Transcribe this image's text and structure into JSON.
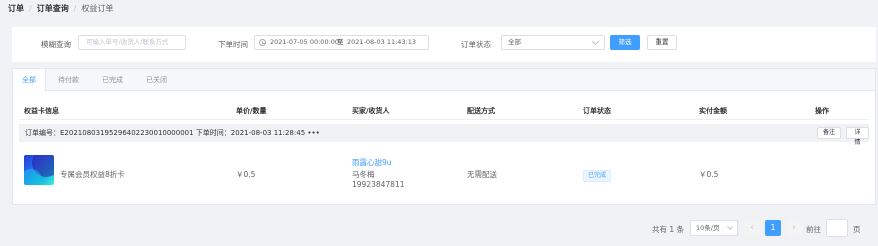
{
  "breadcrumb": {
    "items": [
      "订单",
      "订单查询",
      "权益订单"
    ],
    "separator": "/"
  },
  "filters": {
    "keyword_label": "模糊查询",
    "keyword_placeholder": "可输入单号/收货人/联系方式",
    "time_label": "下单时间",
    "time_start": "2021-07-05 00:00:00",
    "time_sep": "至",
    "time_end": "2021-08-03 11:43:13",
    "status_label": "订单状态",
    "status_value": "全部",
    "filter_button": "筛选",
    "reset_button": "重置"
  },
  "tabs": [
    "全部",
    "待付款",
    "已完成",
    "已关闭"
  ],
  "table": {
    "headers": [
      "权益卡信息",
      "单价/数量",
      "买家/收货人",
      "配送方式",
      "订单状态",
      "实付金额",
      "操作"
    ]
  },
  "order": {
    "info_text": "订单编号：E20210803195296402230010000001 下单时间：2021-08-03 11:28:45 •••",
    "note_button": "备注",
    "detail_button": "详情",
    "item": {
      "name": "专属会员权益8折卡",
      "unit_price": "￥0.5",
      "buyer_nick": "雨露心甜9u",
      "receiver_name": "马冬梅",
      "receiver_phone": "19923847811",
      "delivery": "无需配送",
      "status": "已完成",
      "paid_amount": "￥0.5"
    }
  },
  "pagination": {
    "total_text": "共有 1 条",
    "page_size": "10条/页",
    "current_page": "1",
    "goto_label": "前往",
    "page_suffix": "页",
    "prev_icon": "‹",
    "next_icon": "›"
  },
  "colors": {
    "primary": "#409eff",
    "background": "#f0f2f5"
  }
}
